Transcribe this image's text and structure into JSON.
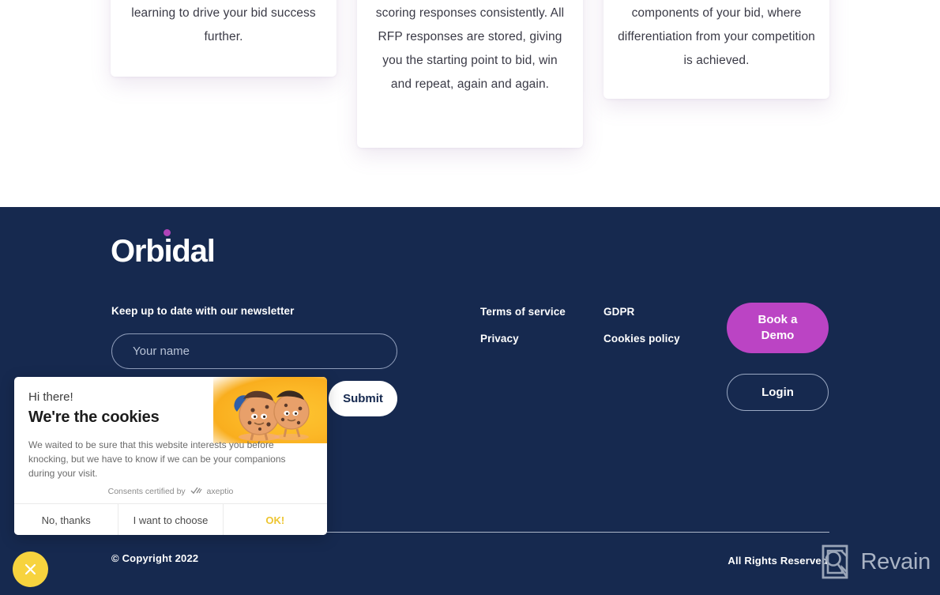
{
  "cards": [
    {
      "text": "learning to drive your bid success further."
    },
    {
      "text": "scoring responses consistently. All RFP responses are stored, giving you the starting point to bid, win and repeat, again and again."
    },
    {
      "text": "components of your bid, where differentiation from your competition is achieved."
    }
  ],
  "footer": {
    "logo_text": "Orbidal",
    "logo_dot_color": "#b043b8",
    "background_color": "#16294f",
    "newsletter": {
      "label": "Keep up to date with our newsletter",
      "input_value": "",
      "input_placeholder": "Your name",
      "submit_label": "Submit"
    },
    "links_column_1": [
      {
        "label": "Terms of service"
      },
      {
        "label": "Privacy"
      }
    ],
    "links_column_2": [
      {
        "label": "GDPR"
      },
      {
        "label": "Cookies policy"
      }
    ],
    "demo_button_label": "Book a\nDemo",
    "demo_button_line1": "Book a",
    "demo_button_line2": "Demo",
    "demo_button_color": "#bb44c4",
    "login_button_label": "Login",
    "copyright": "© Copyright 2022",
    "rights": "All Rights Reserved",
    "watermark_name": "Revain"
  },
  "cookie_banner": {
    "greeting": "Hi there!",
    "title": "We're the cookies",
    "description": "We waited to be sure that this website interests you before knocking, but we have to know if we can be your companions during your visit.",
    "certified_prefix": "Consents certified by",
    "certified_brand": "axeptio",
    "buttons": [
      {
        "label": "No, thanks"
      },
      {
        "label": "I want to choose"
      },
      {
        "label": "OK!",
        "color": "#edc531"
      }
    ]
  },
  "close_widget": {
    "icon": "close-icon",
    "color": "#f7d33e"
  }
}
